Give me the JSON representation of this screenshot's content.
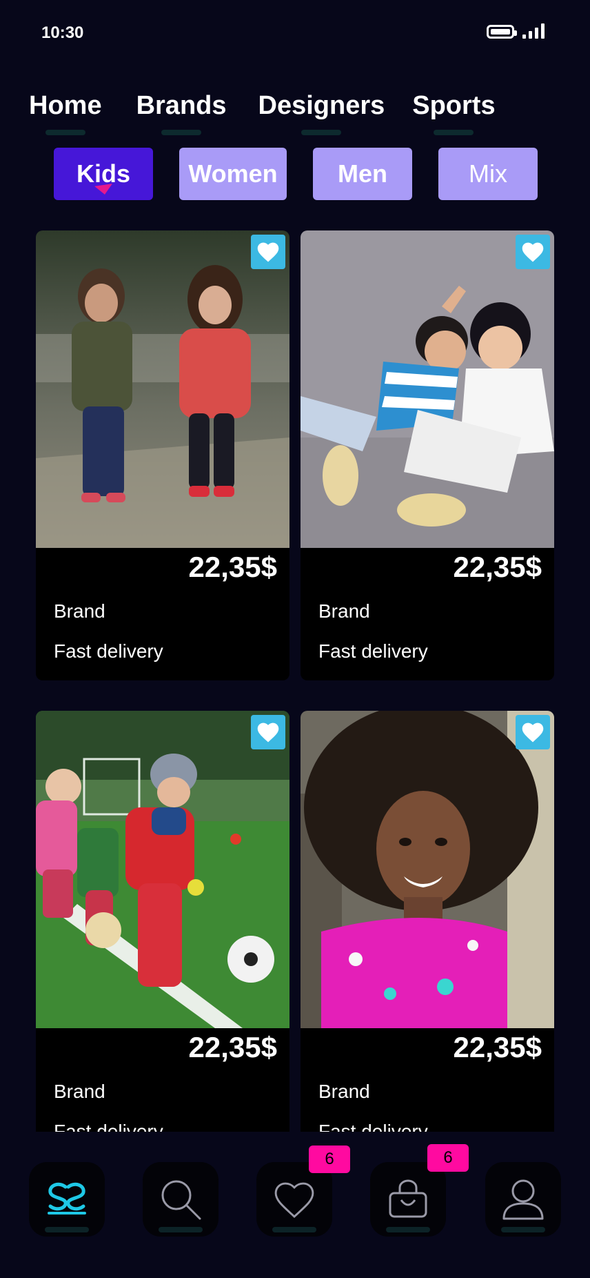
{
  "status_bar": {
    "time": "10:30"
  },
  "nav": {
    "items": [
      {
        "label": "Home"
      },
      {
        "label": "Brands"
      },
      {
        "label": "Designers"
      },
      {
        "label": "Sports"
      }
    ]
  },
  "chips": [
    {
      "label": "Kids",
      "active": true
    },
    {
      "label": "Women",
      "active": false
    },
    {
      "label": "Men",
      "active": false
    },
    {
      "label": "Mix",
      "active": false
    }
  ],
  "products": [
    {
      "price": "22,35$",
      "brand": "Brand",
      "delivery": "Fast delivery",
      "favorite": true
    },
    {
      "price": "22,35$",
      "brand": "Brand",
      "delivery": "Fast delivery",
      "favorite": true
    },
    {
      "price": "22,35$",
      "brand": "Brand",
      "delivery": "Fast delivery",
      "favorite": true
    },
    {
      "price": "22,35$",
      "brand": "Brand",
      "delivery": "Fast delivery",
      "favorite": true
    }
  ],
  "bottom_nav": {
    "tabs": [
      {
        "icon": "logo-icon",
        "active": true
      },
      {
        "icon": "search-icon"
      },
      {
        "icon": "heart-icon",
        "badge": "6"
      },
      {
        "icon": "shopping-bag-icon",
        "badge": "6"
      },
      {
        "icon": "profile-icon"
      }
    ]
  },
  "colors": {
    "background": "#07071a",
    "chip_active": "#4617d8",
    "chip_inactive": "#a99bf7",
    "favorite": "#3cb9e3",
    "badge": "#ff0aa0",
    "pointer": "#e6198d",
    "logo": "#1ec8e6"
  }
}
